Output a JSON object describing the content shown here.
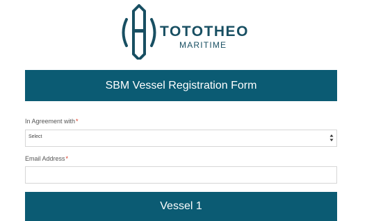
{
  "brand": {
    "name": "TOTOTHEO",
    "subtitle": "MARITIME",
    "color": "#184f62"
  },
  "form": {
    "title": "SBM Vessel Registration Form",
    "banner_color": "#0b5b73",
    "required_mark": "*",
    "required_color": "#d9341f",
    "agreement": {
      "label": "In Agreement with",
      "selected": "Select"
    },
    "email": {
      "label": "Email Address",
      "value": "",
      "placeholder": ""
    },
    "vessel_section": {
      "title": "Vessel 1"
    }
  }
}
